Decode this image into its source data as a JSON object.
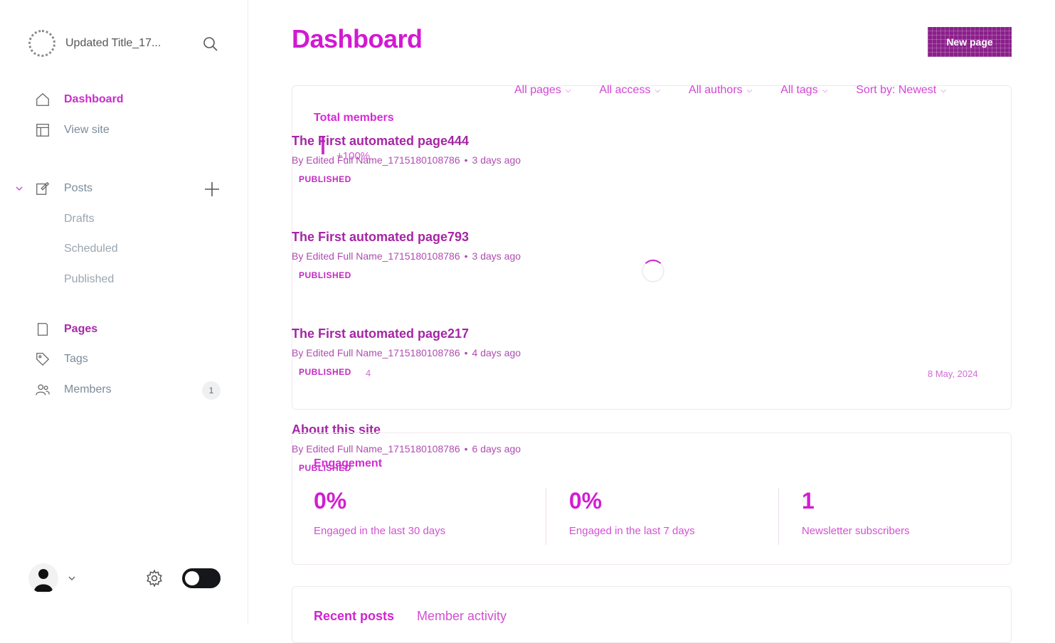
{
  "sidebar": {
    "site_title": "Updated Title_17...",
    "nav": {
      "dashboard": "Dashboard",
      "view_site": "View site",
      "posts": "Posts",
      "drafts": "Drafts",
      "scheduled": "Scheduled",
      "published": "Published",
      "pages": "Pages",
      "tags": "Tags",
      "members": "Members",
      "members_badge": "1"
    },
    "icons": {
      "search": "search-icon",
      "home": "home-icon",
      "view_site": "layout-icon",
      "posts": "edit-icon",
      "add": "plus-icon",
      "pages": "page-icon",
      "tags": "tag-icon",
      "members": "users-icon",
      "settings": "gear-icon"
    }
  },
  "header": {
    "title": "Dashboard",
    "new_page_label": "New page"
  },
  "filters": [
    {
      "label": "All pages"
    },
    {
      "label": "All access"
    },
    {
      "label": "All authors"
    },
    {
      "label": "All tags"
    },
    {
      "label": "Sort by: Newest"
    }
  ],
  "members_card": {
    "heading": "Total members",
    "delta": "+100%",
    "date_label": "8 May, 2024",
    "small_label": "4"
  },
  "pages_list": [
    {
      "title": "The First automated page444",
      "author": "By Edited Full Name_1715180108786",
      "age": "3 days ago",
      "status": "PUBLISHED"
    },
    {
      "title": "The First automated page793",
      "author": "By Edited Full Name_1715180108786",
      "age": "3 days ago",
      "status": "PUBLISHED"
    },
    {
      "title": "The First automated page217",
      "author": "By Edited Full Name_1715180108786",
      "age": "4 days ago",
      "status": "PUBLISHED"
    },
    {
      "title": "About this site",
      "author": "By Edited Full Name_1715180108786",
      "age": "6 days ago",
      "status": "PUBLISHED"
    }
  ],
  "engagement": {
    "heading": "Engagement",
    "stats": [
      {
        "value": "0%",
        "label": "Engaged in the last 30 days"
      },
      {
        "value": "0%",
        "label": "Engaged in the last 7 days"
      },
      {
        "value": "1",
        "label": "Newsletter subscribers"
      }
    ]
  },
  "tabs": {
    "recent_posts": "Recent posts",
    "member_activity": "Member activity"
  },
  "colors": {
    "accent": "#d219d2",
    "primary_button": "#8a1f8a"
  }
}
